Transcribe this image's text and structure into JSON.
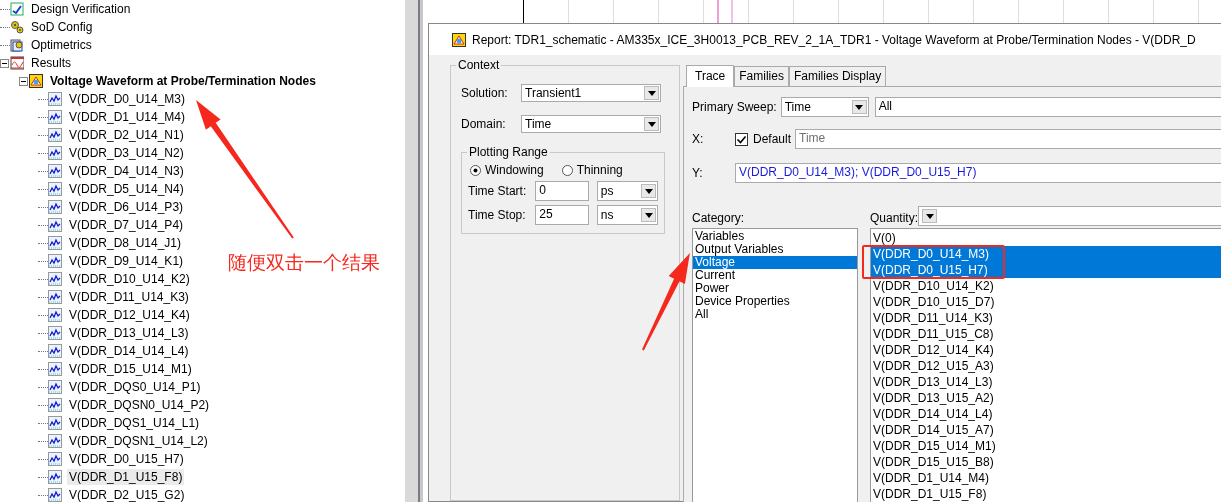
{
  "tree": {
    "items": [
      {
        "label": "Design Verification",
        "kind": "verify"
      },
      {
        "label": "SoD Config",
        "kind": "config"
      },
      {
        "label": "Optimetrics",
        "kind": "optimetrics"
      },
      {
        "label": "Results",
        "kind": "results",
        "expanded": true,
        "children": [
          {
            "label": "Voltage Waveform at Probe/Termination Nodes",
            "kind": "report",
            "expanded": true,
            "children": [
              {
                "label": "V(DDR_D0_U14_M3)",
                "kind": "trace",
                "highlighted": false
              },
              {
                "label": "V(DDR_D1_U14_M4)",
                "kind": "trace",
                "highlighted": false
              },
              {
                "label": "V(DDR_D2_U14_N1)",
                "kind": "trace",
                "highlighted": false
              },
              {
                "label": "V(DDR_D3_U14_N2)",
                "kind": "trace",
                "highlighted": false
              },
              {
                "label": "V(DDR_D4_U14_N3)",
                "kind": "trace",
                "highlighted": false
              },
              {
                "label": "V(DDR_D5_U14_N4)",
                "kind": "trace",
                "highlighted": false
              },
              {
                "label": "V(DDR_D6_U14_P3)",
                "kind": "trace",
                "highlighted": false
              },
              {
                "label": "V(DDR_D7_U14_P4)",
                "kind": "trace",
                "highlighted": false
              },
              {
                "label": "V(DDR_D8_U14_J1)",
                "kind": "trace",
                "highlighted": false
              },
              {
                "label": "V(DDR_D9_U14_K1)",
                "kind": "trace",
                "highlighted": false
              },
              {
                "label": "V(DDR_D10_U14_K2)",
                "kind": "trace",
                "highlighted": false
              },
              {
                "label": "V(DDR_D11_U14_K3)",
                "kind": "trace",
                "highlighted": false
              },
              {
                "label": "V(DDR_D12_U14_K4)",
                "kind": "trace",
                "highlighted": false
              },
              {
                "label": "V(DDR_D13_U14_L3)",
                "kind": "trace",
                "highlighted": false
              },
              {
                "label": "V(DDR_D14_U14_L4)",
                "kind": "trace",
                "highlighted": false
              },
              {
                "label": "V(DDR_D15_U14_M1)",
                "kind": "trace",
                "highlighted": false
              },
              {
                "label": "V(DDR_DQS0_U14_P1)",
                "kind": "trace",
                "highlighted": false
              },
              {
                "label": "V(DDR_DQSN0_U14_P2)",
                "kind": "trace",
                "highlighted": false
              },
              {
                "label": "V(DDR_DQS1_U14_L1)",
                "kind": "trace",
                "highlighted": false
              },
              {
                "label": "V(DDR_DQSN1_U14_L2)",
                "kind": "trace",
                "highlighted": false
              },
              {
                "label": "V(DDR_D0_U15_H7)",
                "kind": "trace",
                "highlighted": false
              },
              {
                "label": "V(DDR_D1_U15_F8)",
                "kind": "trace",
                "highlighted": true
              },
              {
                "label": "V(DDR_D2_U15_G2)",
                "kind": "trace",
                "highlighted": false
              }
            ]
          }
        ]
      }
    ]
  },
  "annotation": {
    "note": "随便双击一个结果"
  },
  "dialog": {
    "title": "Report: TDR1_schematic - AM335x_ICE_3H0013_PCB_REV_2_1A_TDR1 - Voltage Waveform at Probe/Termination Nodes - V(DDR_D",
    "context": {
      "legend": "Context",
      "solution": {
        "label": "Solution:",
        "value": "Transient1"
      },
      "domain": {
        "label": "Domain:",
        "value": "Time"
      },
      "plotting_range": {
        "legend": "Plotting Range",
        "modes": [
          {
            "label": "Windowing",
            "selected": true
          },
          {
            "label": "Thinning",
            "selected": false
          }
        ],
        "time_start": {
          "label": "Time Start:",
          "value": "0",
          "unit": "ps"
        },
        "time_stop": {
          "label": "Time Stop:",
          "value": "25",
          "unit": "ns"
        }
      }
    },
    "tabs": [
      {
        "label": "Trace",
        "selected": true
      },
      {
        "label": "Families",
        "selected": false
      },
      {
        "label": "Families Display",
        "selected": false
      }
    ],
    "primary_sweep": {
      "label": "Primary Sweep:",
      "value": "Time",
      "range": "All"
    },
    "x": {
      "label": "X:",
      "default_label": "Default",
      "checked": true,
      "value": "Time"
    },
    "y": {
      "label": "Y:",
      "value": "V(DDR_D0_U14_M3); V(DDR_D0_U15_H7)"
    },
    "category": {
      "label": "Category:",
      "items": [
        {
          "label": "Variables",
          "selected": false
        },
        {
          "label": "Output Variables",
          "selected": false
        },
        {
          "label": "Voltage",
          "selected": true
        },
        {
          "label": "Current",
          "selected": false
        },
        {
          "label": "Power",
          "selected": false
        },
        {
          "label": "Device Properties",
          "selected": false
        },
        {
          "label": "All",
          "selected": false
        }
      ]
    },
    "quantity": {
      "label": "Quantity:",
      "items": [
        {
          "label": "V(0)",
          "selected": false
        },
        {
          "label": "V(DDR_D0_U14_M3)",
          "selected": true
        },
        {
          "label": "V(DDR_D0_U15_H7)",
          "selected": true
        },
        {
          "label": "V(DDR_D10_U14_K2)",
          "selected": false
        },
        {
          "label": "V(DDR_D10_U15_D7)",
          "selected": false
        },
        {
          "label": "V(DDR_D11_U14_K3)",
          "selected": false
        },
        {
          "label": "V(DDR_D11_U15_C8)",
          "selected": false
        },
        {
          "label": "V(DDR_D12_U14_K4)",
          "selected": false
        },
        {
          "label": "V(DDR_D12_U15_A3)",
          "selected": false
        },
        {
          "label": "V(DDR_D13_U14_L3)",
          "selected": false
        },
        {
          "label": "V(DDR_D13_U15_A2)",
          "selected": false
        },
        {
          "label": "V(DDR_D14_U14_L4)",
          "selected": false
        },
        {
          "label": "V(DDR_D14_U15_A7)",
          "selected": false
        },
        {
          "label": "V(DDR_D15_U14_M1)",
          "selected": false
        },
        {
          "label": "V(DDR_D15_U15_B8)",
          "selected": false
        },
        {
          "label": "V(DDR_D1_U14_M4)",
          "selected": false
        },
        {
          "label": "V(DDR_D1_U15_F8)",
          "selected": false
        }
      ]
    }
  }
}
